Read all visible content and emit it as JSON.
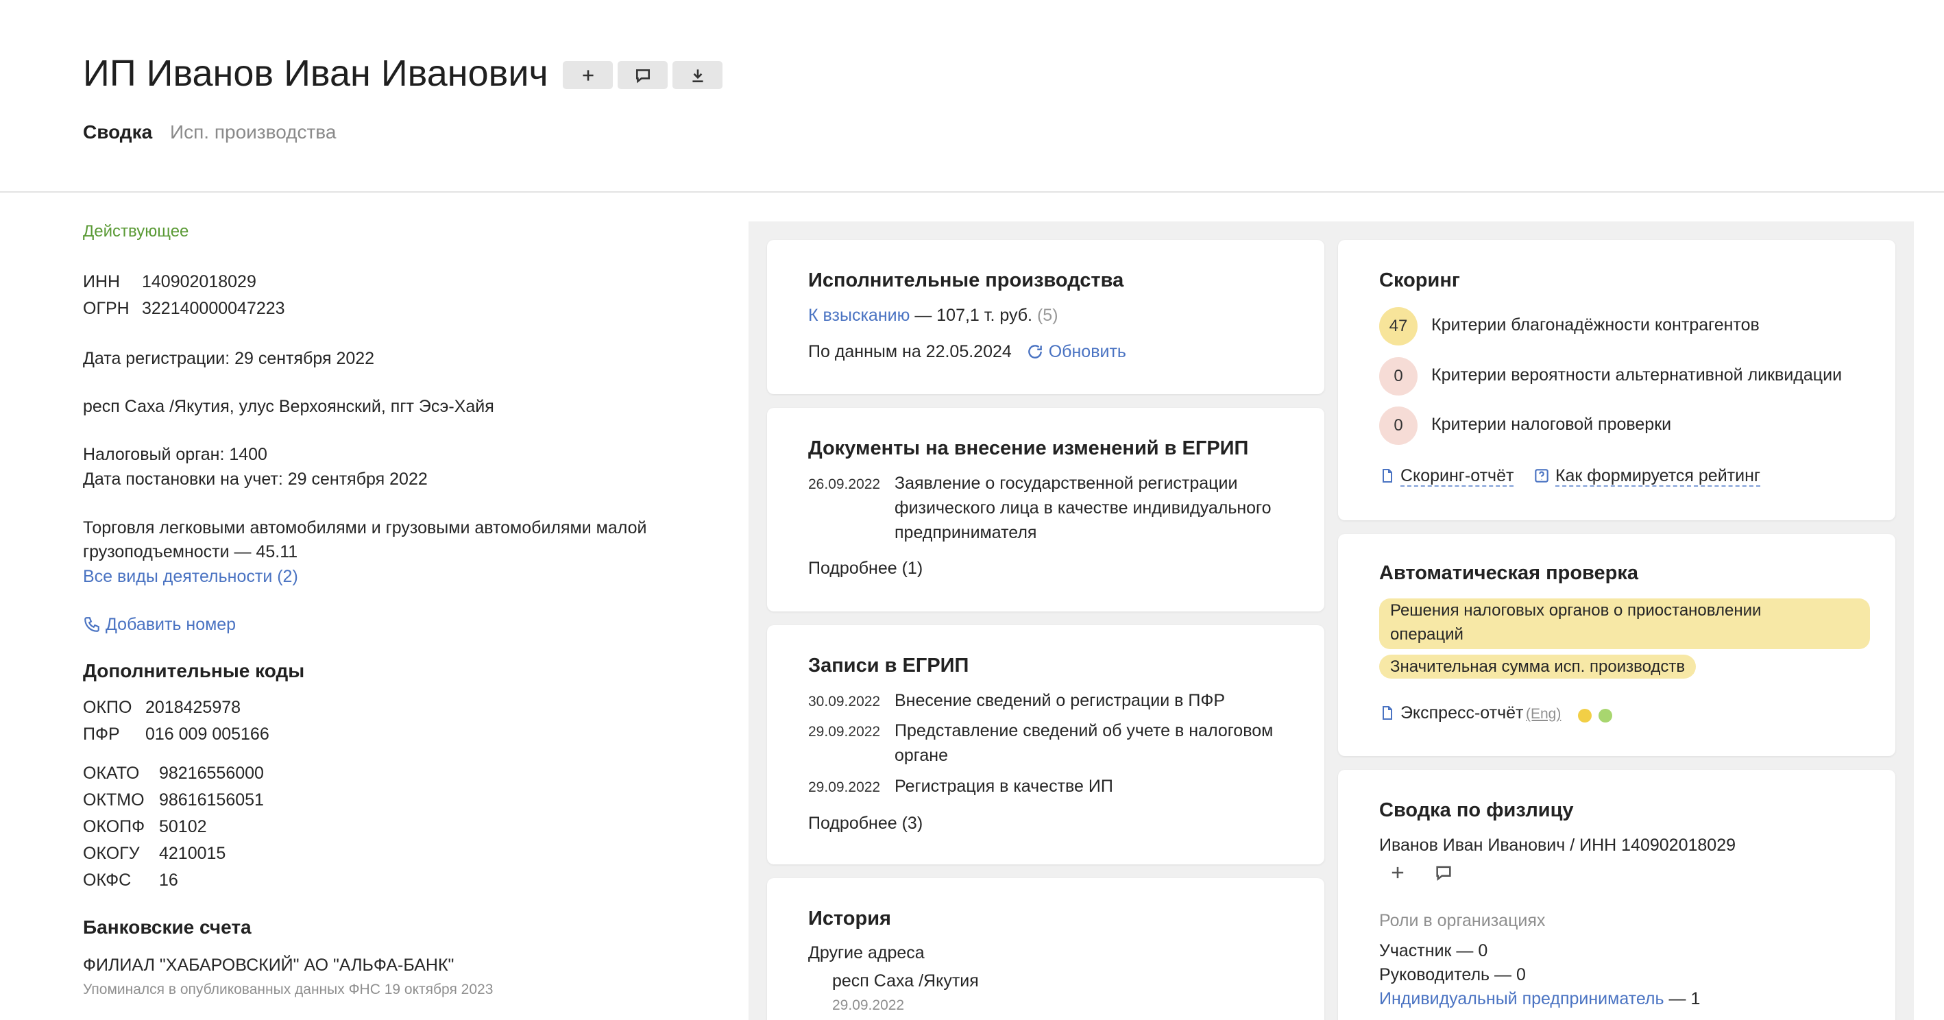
{
  "header": {
    "title": "ИП Иванов Иван Иванович",
    "tabs": [
      {
        "label": "Сводка",
        "active": true
      },
      {
        "label": "Исп. производства",
        "active": false
      }
    ],
    "actions": [
      {
        "icon": "plus-icon"
      },
      {
        "icon": "comment-icon"
      },
      {
        "icon": "download-icon"
      }
    ]
  },
  "summary": {
    "status": "Действующее",
    "inn_label": "ИНН",
    "inn": "140902018029",
    "ogrn_label": "ОГРН",
    "ogrn": "322140000047223",
    "registration": "Дата регистрации: 29 сентября 2022",
    "address": "респ Саха /Якутия, улус Верхоянский, пгт Эсэ-Хайя",
    "tax_office": "Налоговый орган: 1400",
    "tax_registration": "Дата постановки на учет: 29 сентября 2022",
    "activity_line1": "Торговля легковыми автомобилями и грузовыми автомобилями малой",
    "activity_line2": "грузоподъемности — 45.11",
    "all_activities": "Все виды деятельности (2)",
    "add_phone": "Добавить номер"
  },
  "codes": {
    "title": "Дополнительные коды",
    "group1": [
      {
        "label": "ОКПО",
        "value": "2018425978"
      },
      {
        "label": "ПФР",
        "value": "016 009 005166"
      }
    ],
    "group2": [
      {
        "label": "ОКАТО",
        "value": "98216556000"
      },
      {
        "label": "ОКТМО",
        "value": "98616156051"
      },
      {
        "label": "ОКОПФ",
        "value": "50102"
      },
      {
        "label": "ОКОГУ",
        "value": "4210015"
      },
      {
        "label": "ОКФС",
        "value": "16"
      }
    ]
  },
  "bank": {
    "title": "Банковские счета",
    "name": "ФИЛИАЛ \"ХАБАРОВСКИЙ\" АО \"АЛЬФА-БАНК\"",
    "note": "Упоминался в опубликованных данных ФНС 19 октября 2023"
  },
  "enforcement": {
    "title": "Исполнительные производства",
    "link": "К взысканию",
    "amount": "— 107,1 т. руб.",
    "count": "(5)",
    "as_of": "По данным на 22.05.2024",
    "refresh": "Обновить"
  },
  "documents": {
    "title": "Документы на внесение изменений в ЕГРИП",
    "date": "26.09.2022",
    "text_lines": [
      "Заявление о государственной регистрации",
      "физического лица в качестве индивидуального",
      "предпринимателя"
    ],
    "more": "Подробнее (1)"
  },
  "records": {
    "title": "Записи в ЕГРИП",
    "items": [
      {
        "date": "30.09.2022",
        "line1": "Внесение сведений о регистрации в ПФР",
        "line2": ""
      },
      {
        "date": "29.09.2022",
        "line1": "Представление сведений об учете в налоговом",
        "line2": "органе"
      },
      {
        "date": "29.09.2022",
        "line1": "Регистрация в качестве ИП",
        "line2": ""
      }
    ],
    "more": "Подробнее (3)"
  },
  "history": {
    "title": "История",
    "subtitle": "Другие адреса",
    "address": "респ Саха /Якутия",
    "date": "29.09.2022"
  },
  "scoring": {
    "title": "Скоринг",
    "items": [
      {
        "score": "47",
        "label": "Критерии благонадёжности контрагентов",
        "color": "#f7e49a"
      },
      {
        "score": "0",
        "label": "Критерии вероятности альтернативной ликвидации",
        "color": "#f6dcd6"
      },
      {
        "score": "0",
        "label": "Критерии налоговой проверки",
        "color": "#f6dcd6"
      }
    ],
    "report": "Скоринг-отчёт",
    "how": "Как формируется рейтинг"
  },
  "auto_check": {
    "title": "Автоматическая проверка",
    "chip1_line1": "Решения налоговых органов о приостановлении",
    "chip1_line2": "операций",
    "chip2": "Значительная сумма исп. производств",
    "report": "Экспресс-отчёт",
    "eng": "(Eng)",
    "dots": [
      "#f2cf46",
      "#a8d66f"
    ]
  },
  "person": {
    "title": "Сводка по физлицу",
    "link": "Иванов Иван Иванович / ИНН 140902018029",
    "roles_title": "Роли в организациях",
    "participant": "Участник — 0",
    "director": "Руководитель — 0",
    "ip_link": "Индивидуальный предприниматель",
    "ip_count": "— 1"
  },
  "colors": {
    "link": "#4a73c2",
    "status": "#5a9a35",
    "panel_bg": "#f0f0f0"
  }
}
